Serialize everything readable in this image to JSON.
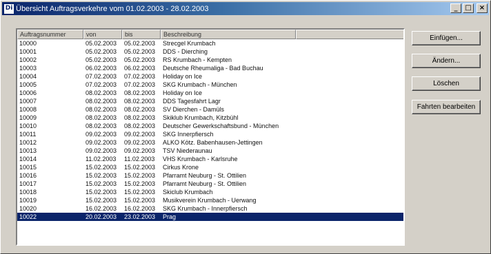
{
  "window": {
    "icon_label": "Di",
    "title": "Übersicht Auftragsverkehre vom 01.02.2003 - 28.02.2003",
    "minimize_label": "_",
    "maximize_label": "□",
    "close_label": "×"
  },
  "table": {
    "columns": [
      "Auftragsnummer",
      "von",
      "bis",
      "Beschreibung"
    ],
    "rows": [
      {
        "nr": "10000",
        "von": "05.02.2003",
        "bis": "05.02.2003",
        "desc": "Strecgel Krumbach"
      },
      {
        "nr": "10001",
        "von": "05.02.2003",
        "bis": "05.02.2003",
        "desc": "DDS - Dierching"
      },
      {
        "nr": "10002",
        "von": "05.02.2003",
        "bis": "05.02.2003",
        "desc": "RS Krumbach - Kempten"
      },
      {
        "nr": "10003",
        "von": "06.02.2003",
        "bis": "06.02.2003",
        "desc": "Deutsche Rheumaliga - Bad Buchau"
      },
      {
        "nr": "10004",
        "von": "07.02.2003",
        "bis": "07.02.2003",
        "desc": "Holiday on Ice"
      },
      {
        "nr": "10005",
        "von": "07.02.2003",
        "bis": "07.02.2003",
        "desc": "SKG Krumbach - München"
      },
      {
        "nr": "10006",
        "von": "08.02.2003",
        "bis": "08.02.2003",
        "desc": "Holiday on Ice"
      },
      {
        "nr": "10007",
        "von": "08.02.2003",
        "bis": "08.02.2003",
        "desc": "DDS Tagesfahrt Lagr"
      },
      {
        "nr": "10008",
        "von": "08.02.2003",
        "bis": "08.02.2003",
        "desc": "SV Dierchen - Damüls"
      },
      {
        "nr": "10009",
        "von": "08.02.2003",
        "bis": "08.02.2003",
        "desc": "Skiklub Krumbach, Kitzbühl"
      },
      {
        "nr": "10010",
        "von": "08.02.2003",
        "bis": "08.02.2003",
        "desc": "Deutscher Gewerkschaftsbund - München"
      },
      {
        "nr": "10011",
        "von": "09.02.2003",
        "bis": "09.02.2003",
        "desc": "SKG Innerpfiersch"
      },
      {
        "nr": "10012",
        "von": "09.02.2003",
        "bis": "09.02.2003",
        "desc": "ALKO Kötz. Babenhausen-Jettingen"
      },
      {
        "nr": "10013",
        "von": "09.02.2003",
        "bis": "09.02.2003",
        "desc": "TSV Niederaunau"
      },
      {
        "nr": "10014",
        "von": "11.02.2003",
        "bis": "11.02.2003",
        "desc": "VHS Krumbach - Karlsruhe"
      },
      {
        "nr": "10015",
        "von": "15.02.2003",
        "bis": "15.02.2003",
        "desc": "Cirkus Krone"
      },
      {
        "nr": "10016",
        "von": "15.02.2003",
        "bis": "15.02.2003",
        "desc": "Pfarramt Neuburg - St. Ottilien"
      },
      {
        "nr": "10017",
        "von": "15.02.2003",
        "bis": "15.02.2003",
        "desc": "Pfarramt Neuburg - St. Ottilien"
      },
      {
        "nr": "10018",
        "von": "15.02.2003",
        "bis": "15.02.2003",
        "desc": "Skiclub Krumbach"
      },
      {
        "nr": "10019",
        "von": "15.02.2003",
        "bis": "15.02.2003",
        "desc": "Musikverein Krumbach - Uerwang"
      },
      {
        "nr": "10020",
        "von": "16.02.2003",
        "bis": "16.02.2003",
        "desc": "SKG Krumbach - Innerpfiersch"
      },
      {
        "nr": "10022",
        "von": "20.02.2003",
        "bis": "23.02.2003",
        "desc": "Prag"
      }
    ],
    "selected_index": 21
  },
  "buttons": {
    "insert": "Einfügen...",
    "change": "Ändern...",
    "delete": "Löschen",
    "edit_trips": "Fahrten bearbeiten"
  }
}
